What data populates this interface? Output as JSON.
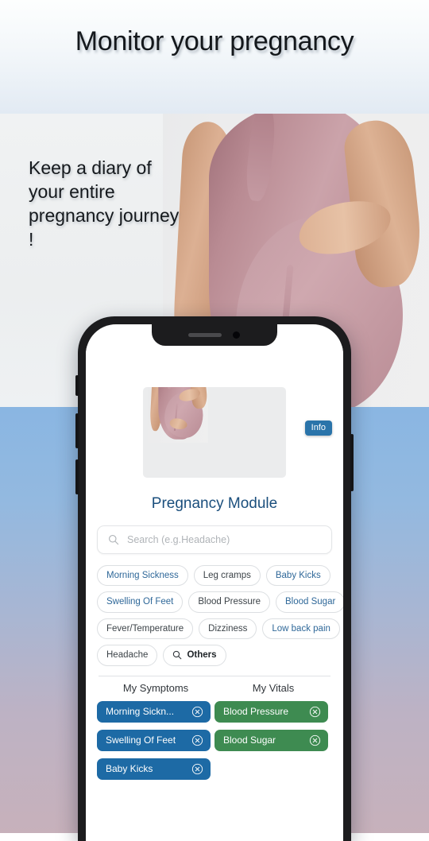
{
  "banner": {
    "headline": "Monitor your pregnancy",
    "subheadline": "Keep a diary of your entire pregnancy journey !",
    "headline_color": "#14181c",
    "band_gradient_top": "#fdfefe",
    "band_gradient_bottom": "#e2eaf3",
    "lower_gradient_top": "#8ab6e2",
    "lower_gradient_bottom": "#c7b1bb"
  },
  "phone": {
    "notch_icons": [
      "speaker-grille",
      "front-camera"
    ]
  },
  "app": {
    "hero": {
      "image_alt": "pregnant-woman-photo",
      "info_badge": "Info",
      "info_badge_color": "#2a74aa"
    },
    "title": "Pregnancy Module",
    "title_color": "#1b4f7d",
    "search": {
      "icon": "search-icon",
      "placeholder": "Search (e.g.Headache)",
      "value": ""
    },
    "chip_rows": [
      [
        {
          "label": "Morning Sickness",
          "style": "blue"
        },
        {
          "label": "Leg cramps",
          "style": "dark"
        },
        {
          "label": "Baby Kicks",
          "style": "blue"
        }
      ],
      [
        {
          "label": "Swelling Of Feet",
          "style": "blue"
        },
        {
          "label": "Blood Pressure",
          "style": "dark"
        },
        {
          "label": "Blood Sugar",
          "style": "blue"
        }
      ],
      [
        {
          "label": "Fever/Temperature",
          "style": "dark"
        },
        {
          "label": "Dizziness",
          "style": "dark"
        },
        {
          "label": "Low back pain",
          "style": "blue"
        }
      ],
      [
        {
          "label": "Headache",
          "style": "dark"
        },
        {
          "label": "Others",
          "style": "others",
          "icon": "search-icon"
        }
      ]
    ],
    "columns": [
      {
        "heading": "My Symptoms",
        "color": "#1d6aa5",
        "items": [
          {
            "label": "Morning Sickn...",
            "remove_icon": "close-circle-icon"
          },
          {
            "label": "Swelling Of Feet",
            "remove_icon": "close-circle-icon"
          },
          {
            "label": "Baby Kicks",
            "remove_icon": "close-circle-icon"
          }
        ]
      },
      {
        "heading": "My Vitals",
        "color": "#3e8b51",
        "items": [
          {
            "label": "Blood Pressure",
            "remove_icon": "close-circle-icon"
          },
          {
            "label": "Blood Sugar",
            "remove_icon": "close-circle-icon"
          }
        ]
      }
    ]
  }
}
